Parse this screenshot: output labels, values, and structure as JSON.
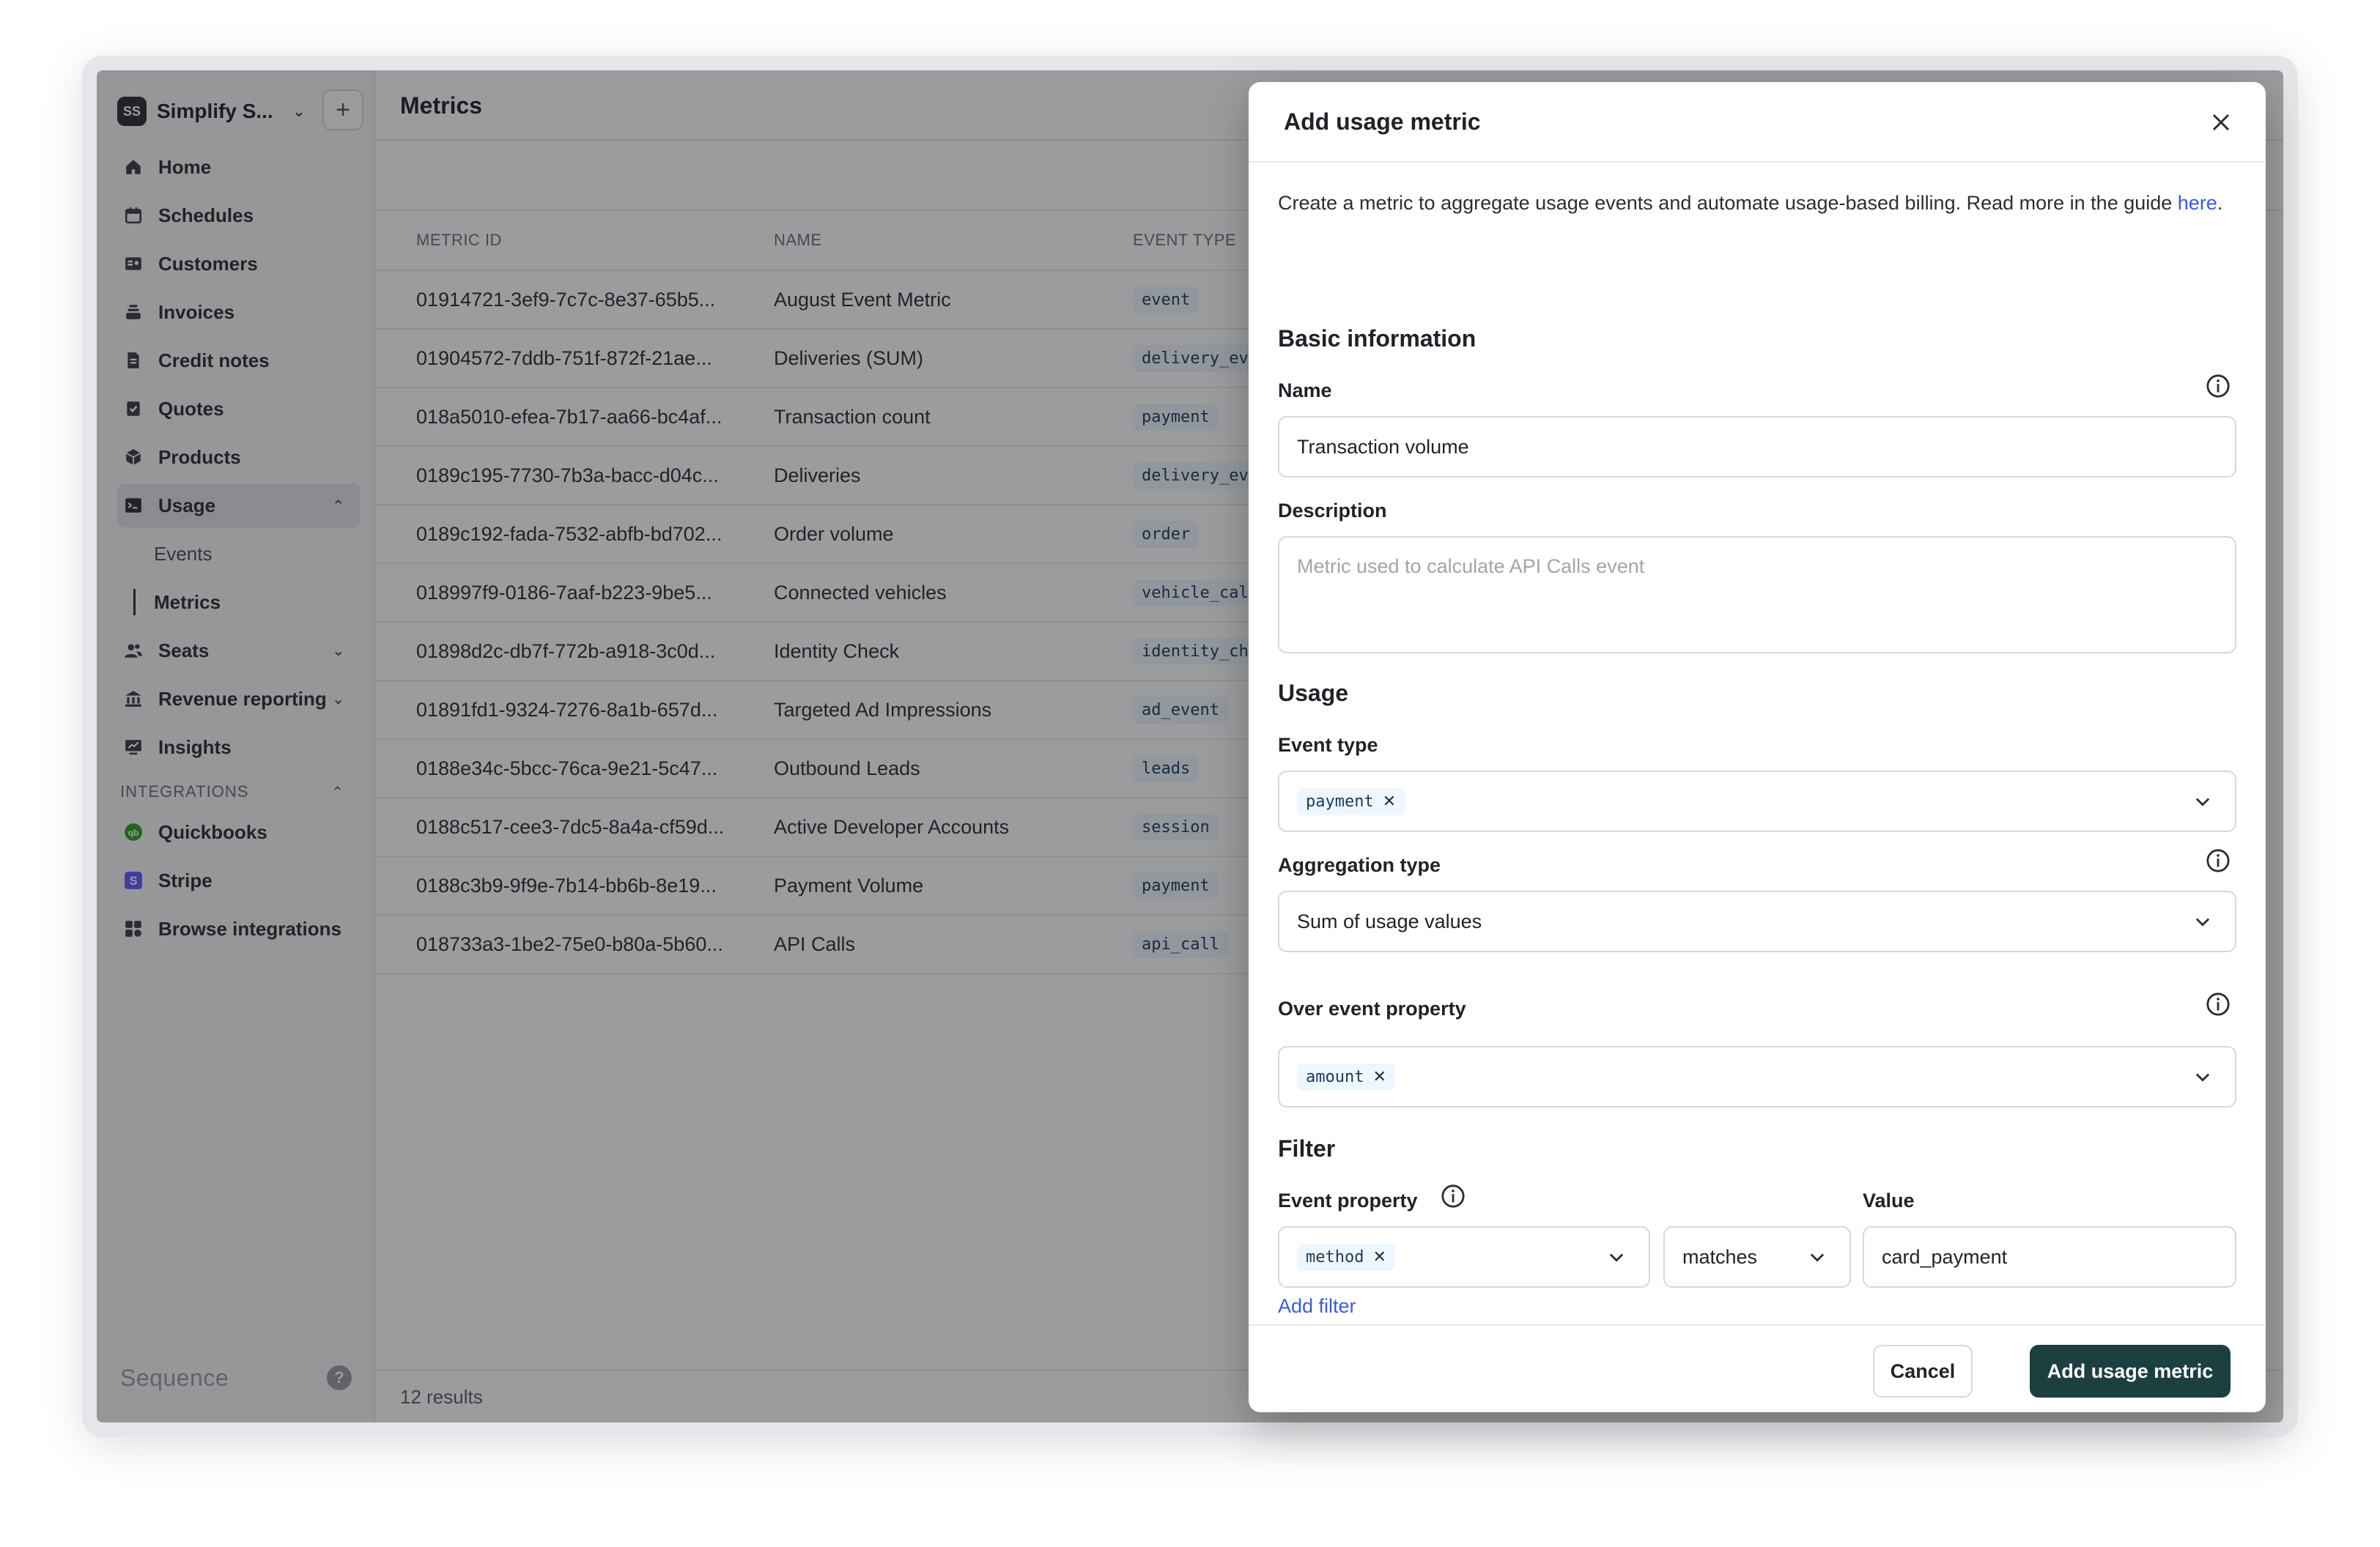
{
  "workspace": {
    "initials": "SS",
    "name": "Simplify S..."
  },
  "sidebar": {
    "items": [
      {
        "label": "Home",
        "icon": "home-icon"
      },
      {
        "label": "Schedules",
        "icon": "calendar-icon"
      },
      {
        "label": "Customers",
        "icon": "id-card-icon"
      },
      {
        "label": "Invoices",
        "icon": "stack-icon"
      },
      {
        "label": "Credit notes",
        "icon": "document-icon"
      },
      {
        "label": "Quotes",
        "icon": "check-doc-icon"
      },
      {
        "label": "Products",
        "icon": "box-icon"
      },
      {
        "label": "Usage",
        "icon": "terminal-icon"
      }
    ],
    "usage_sub": [
      {
        "label": "Events"
      },
      {
        "label": "Metrics"
      }
    ],
    "items_after": [
      {
        "label": "Seats",
        "icon": "users-icon"
      },
      {
        "label": "Revenue reporting",
        "icon": "bank-icon"
      },
      {
        "label": "Insights",
        "icon": "chart-icon"
      }
    ],
    "integrations_label": "INTEGRATIONS",
    "integrations": [
      {
        "label": "Quickbooks",
        "icon": "quickbooks-icon",
        "color": "#2ca01c"
      },
      {
        "label": "Stripe",
        "icon": "stripe-icon",
        "color": "#635bff"
      },
      {
        "label": "Browse integrations",
        "icon": "grid-icon"
      }
    ],
    "brand": "Sequence"
  },
  "main": {
    "title": "Metrics",
    "columns": {
      "id": "METRIC ID",
      "name": "NAME",
      "type": "EVENT TYPE"
    },
    "rows": [
      {
        "id": "01914721-3ef9-7c7c-8e37-65b5...",
        "name": "August Event Metric",
        "type": "event"
      },
      {
        "id": "01904572-7ddb-751f-872f-21ae...",
        "name": "Deliveries (SUM)",
        "type": "delivery_eve"
      },
      {
        "id": "018a5010-efea-7b17-aa66-bc4af...",
        "name": "Transaction count",
        "type": "payment"
      },
      {
        "id": "0189c195-7730-7b3a-bacc-d04c...",
        "name": "Deliveries",
        "type": "delivery_eve"
      },
      {
        "id": "0189c192-fada-7532-abfb-bd702...",
        "name": "Order volume",
        "type": "order"
      },
      {
        "id": "018997f9-0186-7aaf-b223-9be5...",
        "name": "Connected vehicles",
        "type": "vehicle_call"
      },
      {
        "id": "01898d2c-db7f-772b-a918-3c0d...",
        "name": "Identity Check",
        "type": "identity_che"
      },
      {
        "id": "01891fd1-9324-7276-8a1b-657d...",
        "name": "Targeted Ad Impressions",
        "type": "ad_event"
      },
      {
        "id": "0188e34c-5bcc-76ca-9e21-5c47...",
        "name": "Outbound Leads",
        "type": "leads"
      },
      {
        "id": "0188c517-cee3-7dc5-8a4a-cf59d...",
        "name": "Active Developer Accounts",
        "type": "session"
      },
      {
        "id": "0188c3b9-9f9e-7b14-bb6b-8e19...",
        "name": "Payment Volume",
        "type": "payment"
      },
      {
        "id": "018733a3-1be2-75e0-b80a-5b60...",
        "name": "API Calls",
        "type": "api_call"
      }
    ],
    "results": "12 results"
  },
  "modal": {
    "title": "Add usage metric",
    "intro": "Create a metric to aggregate usage events and automate usage-based billing. Read more in the guide ",
    "intro_link": "here",
    "intro_end": ".",
    "basic_info": "Basic information",
    "name_label": "Name",
    "name_value": "Transaction volume",
    "description_label": "Description",
    "description_placeholder": "Metric used to calculate API Calls event",
    "usage_heading": "Usage",
    "event_type_label": "Event type",
    "event_type_chip": "payment",
    "aggregation_label": "Aggregation type",
    "aggregation_value": "Sum of usage values",
    "over_property_label": "Over event property",
    "over_property_chip": "amount",
    "filter_heading": "Filter",
    "event_property_label": "Event property",
    "event_property_chip": "method",
    "operator_value": "matches",
    "value_label": "Value",
    "value_value": "card_payment",
    "add_filter": "Add filter",
    "cancel": "Cancel",
    "submit": "Add usage metric"
  }
}
